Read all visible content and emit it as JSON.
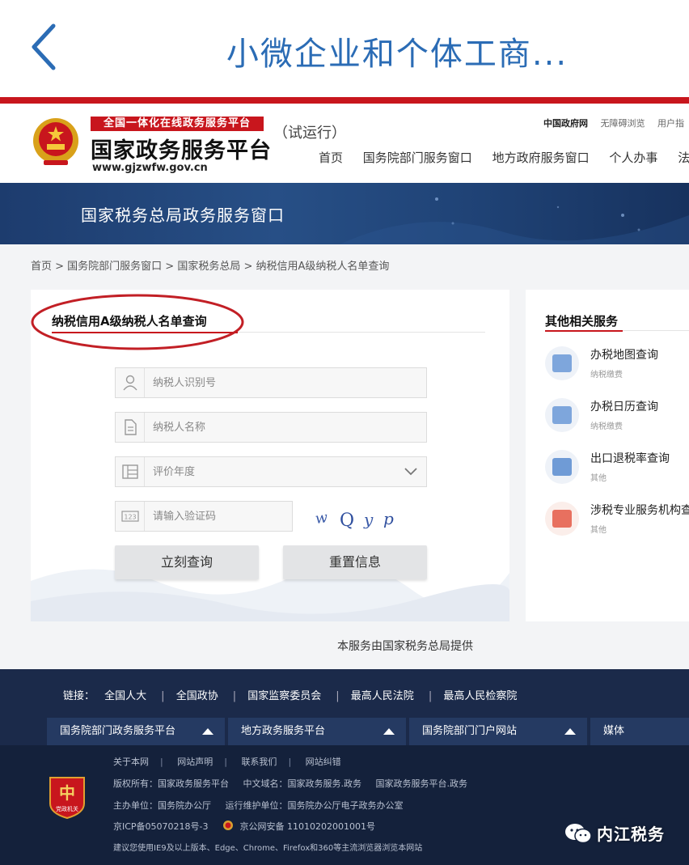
{
  "app": {
    "title": "小微企业和个体工商..."
  },
  "site": {
    "slogan": "全国一体化在线政务服务平台",
    "name": "国家政务服务平台",
    "url": "www.gjzwfw.gov.cn",
    "trial": "（试运行）",
    "top_links": [
      "中国政府网",
      "无障碍浏览",
      "用户指"
    ],
    "nav": [
      "首页",
      "国务院部门服务窗口",
      "地方政府服务窗口",
      "个人办事",
      "法人"
    ]
  },
  "banner": {
    "title": "国家税务总局政务服务窗口"
  },
  "breadcrumb": "首页 > 国务院部门服务窗口 > 国家税务总局 > 纳税信用A级纳税人名单查询",
  "form": {
    "title": "纳税信用A级纳税人名单查询",
    "taxpayer_id_placeholder": "纳税人识别号",
    "taxpayer_name_placeholder": "纳税人名称",
    "year_placeholder": "评价年度",
    "captcha_placeholder": "请输入验证码",
    "captcha_text": "wQyp",
    "submit_label": "立刻查询",
    "reset_label": "重置信息"
  },
  "related": {
    "title": "其他相关服务",
    "items": [
      {
        "name": "办税地图查询",
        "sub": "纳税缴费",
        "color": "#7ea6dc"
      },
      {
        "name": "办税日历查询",
        "sub": "纳税缴费",
        "color": "#7ea6dc"
      },
      {
        "name": "出口退税率查询",
        "sub": "其他",
        "color": "#6f9bd6"
      },
      {
        "name": "涉税专业服务机构查",
        "sub": "其他",
        "color": "#e8705f"
      }
    ]
  },
  "provided_by": "本服务由国家税务总局提供",
  "footer": {
    "links_label": "链接：",
    "links": [
      "全国人大",
      "全国政协",
      "国家监察委员会",
      "最高人民法院",
      "最高人民检察院"
    ],
    "selects": [
      "国务院部门政务服务平台",
      "地方政务服务平台",
      "国务院部门门户网站",
      "媒体"
    ],
    "row1": [
      "关于本网",
      "网站声明",
      "联系我们",
      "网站纠错"
    ],
    "copyright": "版权所有：国家政务服务平台",
    "domain_cn": "中文域名：国家政务服务.政务",
    "domain_cn2": "国家政务服务平台.政务",
    "host": "主办单位：国务院办公厅",
    "ops": "运行维护单位：国务院办公厅电子政务办公室",
    "icp": "京ICP备05070218号-3",
    "police": "京公网安备 11010202001001号",
    "browser": "建议您使用IE9及以上版本、Edge、Chrome、Firefox和360等主流浏览器浏览本网站",
    "badge_text": "党政机关"
  },
  "watermark": "内江税务",
  "colors": {
    "accent_red": "#c8161d",
    "title_blue": "#2b6cb5",
    "banner_blue": "#1d3c6e",
    "footer_navy": "#1b2a4a"
  },
  "icons": [
    "back-chevron-icon",
    "national-emblem-icon",
    "user-icon",
    "document-icon",
    "calendar-grid-icon",
    "numeric-123-icon",
    "chevron-down-icon",
    "map-icon",
    "calendar-icon",
    "export-icon",
    "service-org-icon",
    "party-gov-badge-icon",
    "police-badge-icon",
    "wechat-icon"
  ]
}
